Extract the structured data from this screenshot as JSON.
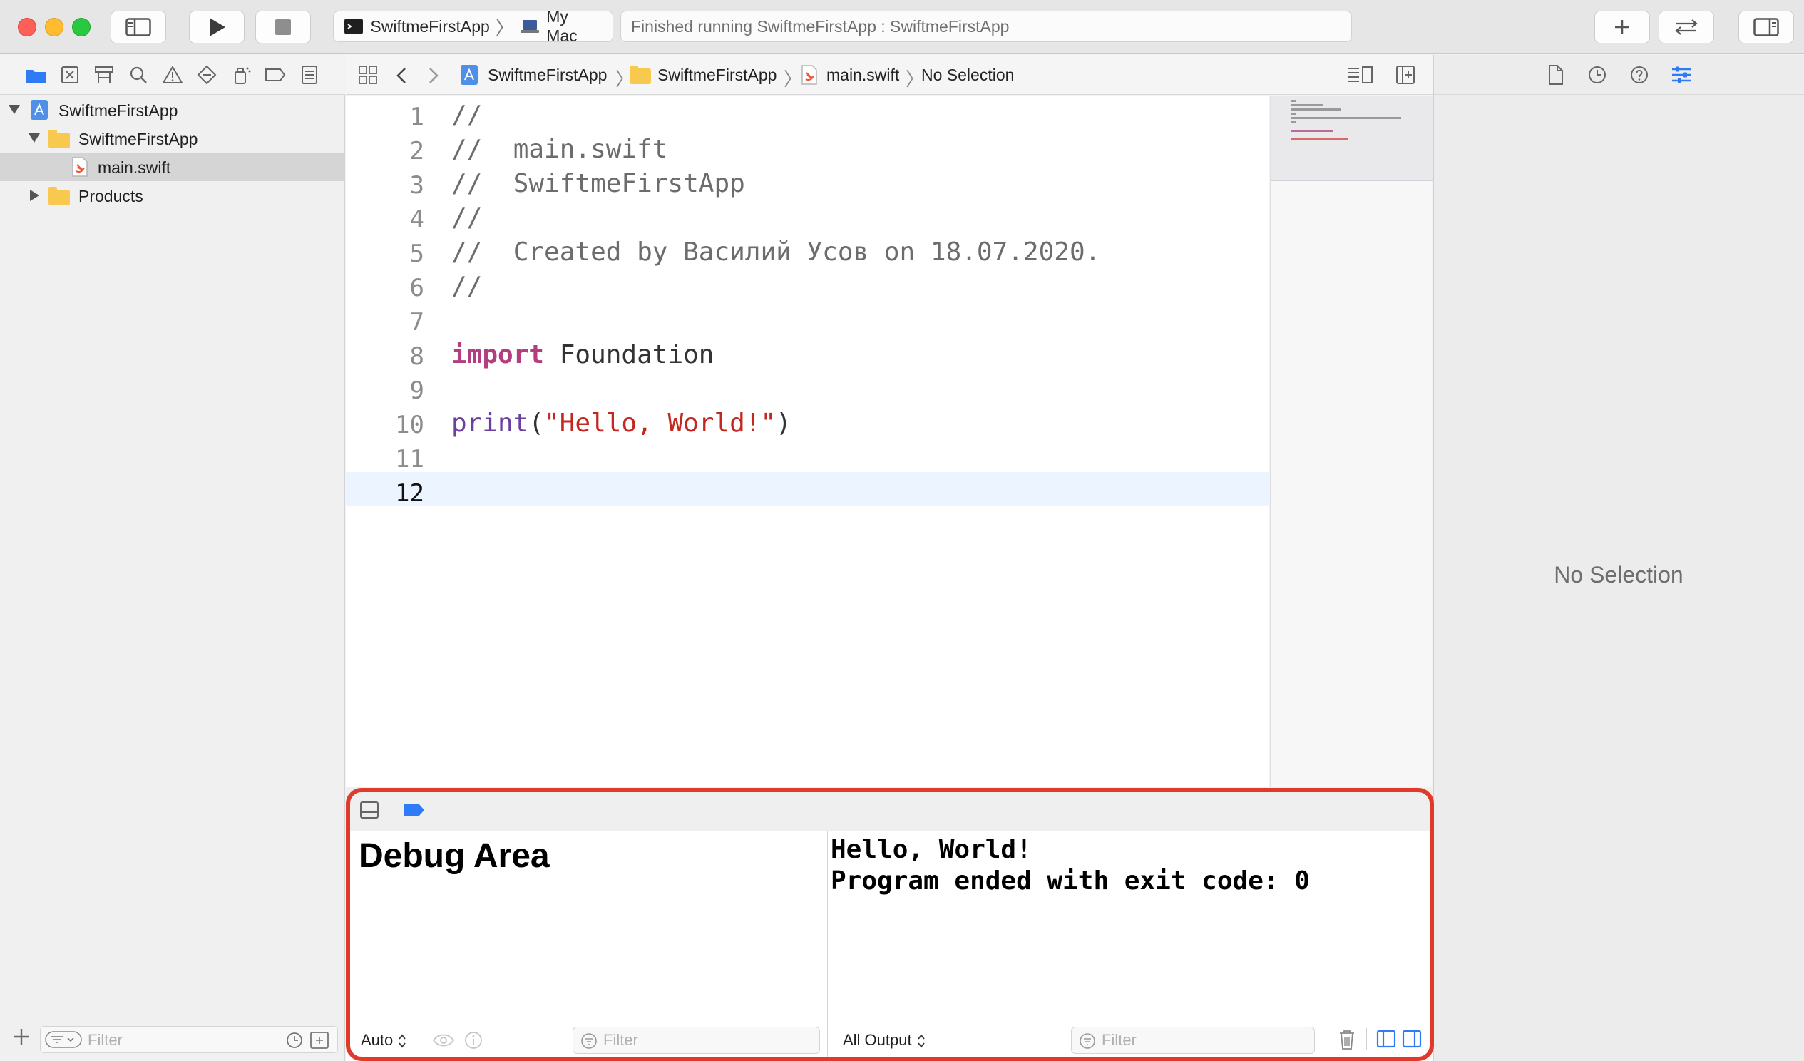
{
  "toolbar": {
    "scheme": "SwiftmeFirstApp",
    "destination": "My Mac",
    "status": "Finished running SwiftmeFirstApp : SwiftmeFirstApp"
  },
  "navigator": {
    "items": [
      {
        "label": "SwiftmeFirstApp"
      },
      {
        "label": "SwiftmeFirstApp"
      },
      {
        "label": "main.swift"
      },
      {
        "label": "Products"
      }
    ],
    "filter_placeholder": "Filter"
  },
  "jumpbar": {
    "project": "SwiftmeFirstApp",
    "group": "SwiftmeFirstApp",
    "file": "main.swift",
    "selection": "No Selection"
  },
  "editor": {
    "lines": [
      {
        "n": "1",
        "text": "//"
      },
      {
        "n": "2",
        "text": "//  main.swift"
      },
      {
        "n": "3",
        "text": "//  SwiftmeFirstApp"
      },
      {
        "n": "4",
        "text": "//"
      },
      {
        "n": "5",
        "text": "//  Created by Василий Усов on 18.07.2020."
      },
      {
        "n": "6",
        "text": "//"
      },
      {
        "n": "7",
        "text": ""
      },
      {
        "n": "8",
        "keyword": "import",
        "rest": " Foundation"
      },
      {
        "n": "9",
        "text": ""
      },
      {
        "n": "10",
        "func": "print",
        "open": "(",
        "string": "\"Hello, World!\"",
        "close": ")"
      },
      {
        "n": "11",
        "text": ""
      },
      {
        "n": "12",
        "text": ""
      }
    ]
  },
  "inspector": {
    "empty_label": "No Selection"
  },
  "debug": {
    "title": "Debug Area",
    "output_lines": [
      "Hello, World!",
      "Program ended with exit code: 0"
    ],
    "variables_scope": "Auto",
    "output_scope": "All Output",
    "filter_placeholder": "Filter"
  },
  "colors": {
    "highlight_border": "#e23a2a",
    "accent": "#2f7bf5",
    "keyword": "#b43d80",
    "string": "#c4271f",
    "function": "#6b3fa0"
  }
}
